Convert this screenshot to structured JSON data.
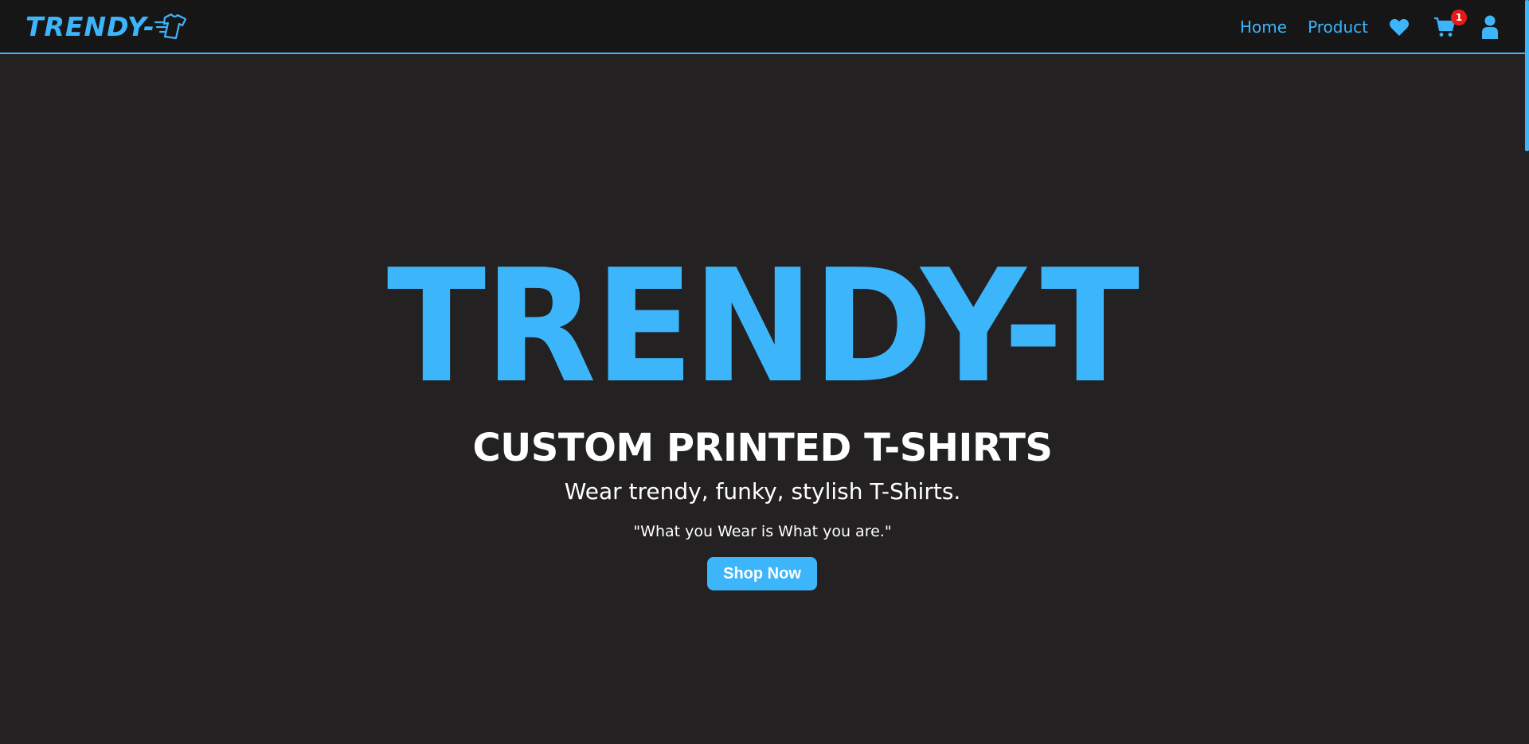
{
  "navbar": {
    "logo_text": "TRENDY-",
    "links": [
      {
        "label": "Home"
      },
      {
        "label": "Product"
      }
    ],
    "icons": [
      "heart-icon",
      "cart-icon",
      "user-icon"
    ],
    "cart_count": "1"
  },
  "hero": {
    "title": "TRENDY-T",
    "subtitle": "CUSTOM PRINTED T-SHIRTS",
    "tagline": "Wear trendy, funky, stylish T-Shirts.",
    "quote": "\"What you Wear is What you are.\"",
    "cta_label": "Shop Now"
  },
  "colors": {
    "accent": "#3db5fb",
    "background": "#232122",
    "navbar_bg": "#171617",
    "badge": "#e41a1a",
    "text": "#ffffff"
  }
}
